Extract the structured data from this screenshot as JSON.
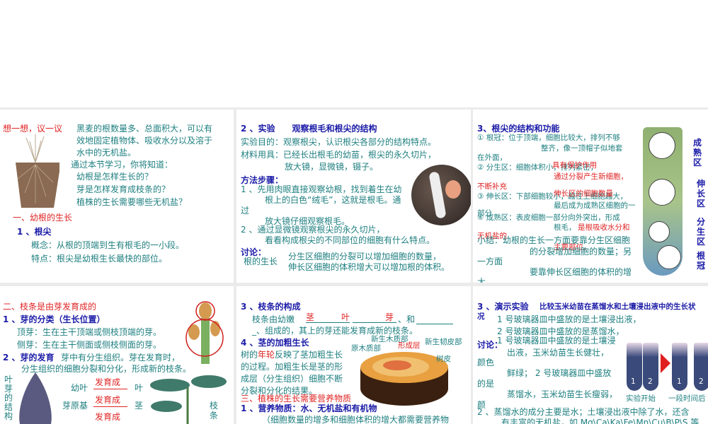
{
  "slide1": {
    "title": "想一想，议一议",
    "p1": "黑麦的根数量多、总面积大，可以有",
    "p2": "效地固定植物体、吸收水分以及溶于",
    "p3": "水中的无机盐。",
    "p4": "通过本节学习，你将知道：",
    "q1": "幼根是怎样生长的？",
    "q2": "芽是怎样发育成枝条的？",
    "q3": "植株的生长需要哪些无机盐？",
    "h1": "一、幼根的生长",
    "h2": "1 、根尖",
    "c1": "概念：从根的顶端到生有根毛的一小段。",
    "c2": "特点：根尖是幼根生长最快的部位。"
  },
  "slide2": {
    "title": "2 、实验　　观察根毛和根尖的结构",
    "aim": "实验目的：观察根尖，认识根尖各部分的结构特点。",
    "mat1": "材料用具：已经长出根毛的幼苗，根尖的永久切片，",
    "mat2": "放大镜，显微镜，镊子。",
    "steps": "方法步骤：",
    "s1a": "1 、先用肉眼直接观察幼根，找到着生在幼",
    "s1b": "根上的白色“绒毛”，这就是根毛。通",
    "s1c": "过",
    "s1d": "放大镜仔细观察根毛。",
    "s2a": "2 、通过显微镜观察根尖的永久切片，",
    "s2b": "看看构成根尖的不同部位的细胞有什么特点。",
    "disc": "讨论：",
    "root": "根的生长",
    "d1": "分生区细胞的分裂可以增加细胞的数量，",
    "d2": "伸长区细胞的体积增大可以增加根的体积。"
  },
  "slide3": {
    "title": "3、根尖的结构和功能",
    "l1": "① 根冠：位于顶端，细胞比较大，排列不够",
    "l2": "整齐，像一顶帽子似地套",
    "l3": "在外面，",
    "l4": "② 分生区：细胞体积小，排列紧密，",
    "l4r": "具有保护作用",
    "l5": "通过分裂产生新细胞，",
    "l6": "不断补充",
    "l7": "③ 伸长区：下部细胞较小，越往上细胞越大，",
    "l7r": "伸长区的细胞数量",
    "l8": "最后成为成熟区细胞的一",
    "l9": "部分",
    "l10": "④ 成熟区：表皮细胞一部分向外突出，形成",
    "l11": "根毛，",
    "l11r": "是根吸收水分和",
    "l12": "无机盐的",
    "l12r": "主要部位。",
    "sum1": "小结：幼根的生长一方面要靠分生区细胞",
    "sum2": "的分裂增加细胞的数量；另",
    "sum3": "一方面",
    "sum4": "要靠伸长区细胞的体积的增",
    "sum5": "大。",
    "labels": [
      "成熟区",
      "伸长区",
      "分生区",
      "根冠"
    ]
  },
  "slide4": {
    "title": "二、枝条是由芽发育成的",
    "h1": "1 、芽的分类（生长位置）",
    "a1": "顶芽：生在主干顶端或侧枝顶端的芽。",
    "a2": "侧芽：生在主干侧面或侧枝侧面的芽。",
    "h2": "2 、芽的发育",
    "h2b": "芽中有分生组织。芽在发育时，",
    "a3": "分生组织的细胞分裂和分化，形成新的枝条。",
    "side": "叶芽的结构",
    "young": "幼叶",
    "dev1": "发育成",
    "leaf": "叶",
    "base": "芽原基",
    "dev2": "发育成",
    "stem": "茎",
    "dev3": "发育成",
    "branch": "枝条"
  },
  "slide5": {
    "h1": "3 、枝条的构成",
    "f1": "枝条由幼嫩",
    "ans1": "茎",
    "ans2": "叶",
    "ans3": "芽",
    "and": "、和",
    "f2": "_、组成的，其上的芽还能发育成新的枝条。",
    "h2": "4 、茎的加粗生长",
    "t1a": "树的",
    "t1r": "年轮",
    "t1b": "反映了茎加粗生长",
    "t2": "的过程。加粗生长是茎的形",
    "t3": "成层（分生组织）细胞不断",
    "t4": "分裂和分化的结果。",
    "lb1": "新生木质部",
    "lb2": "原木质部",
    "lb3": "形成层",
    "lb4": "新生韧皮部",
    "lb5": "树皮",
    "h3": "三、植株的生长需要营养物质",
    "h4": "1 、营养物质：水、无机盐和有机物",
    "t5": "（细胞数量的增多和细胞体积的增大都需要营养物"
  },
  "slide6": {
    "h1": "3 、演示实验",
    "h1b": "比较玉米幼苗在蒸馏水和土壤浸出液中的生长状",
    "h1c": "况",
    "l1": "1 号玻璃器皿中盛放的是土壤浸出液，",
    "l2": "2 号玻璃器皿中盛放的是蒸馏水，",
    "disc": "讨论：",
    "l3": "1 号玻璃器皿中盛放的是土壤浸",
    "l4": "出液，玉米幼苗生长健壮，",
    "l5": "颜色",
    "l6": "鲜绿； 2 号玻璃器皿中盛放",
    "l7": "的是",
    "l8": "蒸馏水，玉米幼苗生长瘦弱，",
    "l9": "颜",
    "l10": "2 、蒸馏水的成分主要是水；土壤浸出液中除了水，还含",
    "l11": "有丰富的无机盐，如 Mg\\Ca\\Ka\\Fe\\Mn\\Cu\\B\\P\\S 等",
    "start": "实验开始",
    "after": "一段时间后",
    "tube_labels": [
      "1",
      "2",
      "1",
      "2"
    ]
  }
}
